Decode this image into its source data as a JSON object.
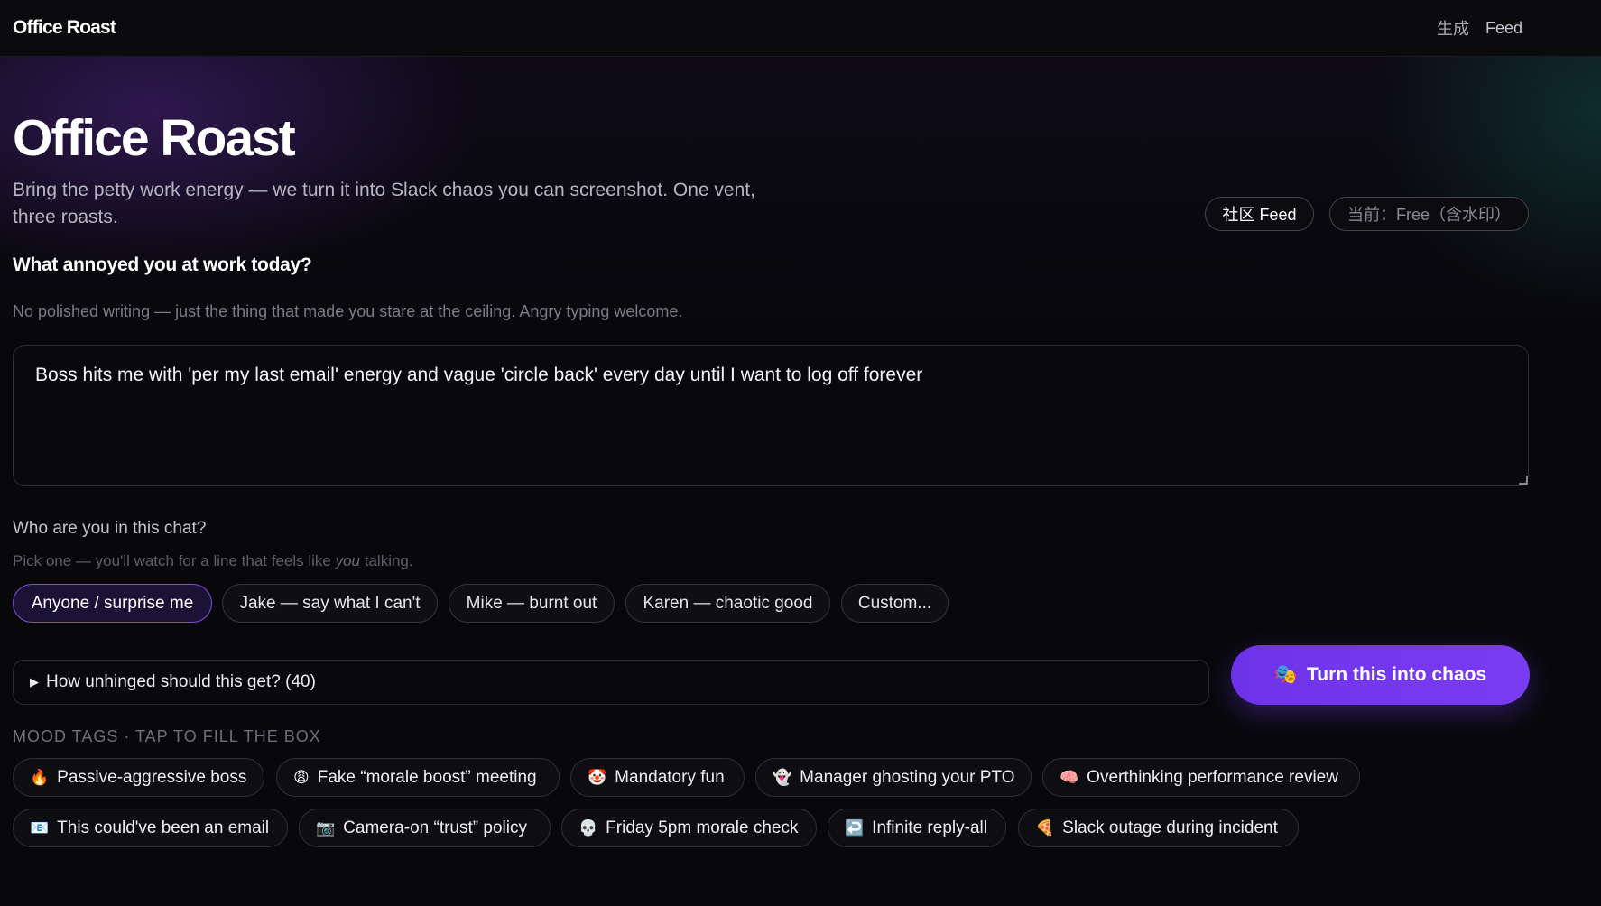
{
  "nav": {
    "brand": "Office Roast",
    "links": [
      "生成",
      "Feed"
    ]
  },
  "hero": {
    "title": "Office Roast",
    "subtitle": "Bring the petty work energy — we turn it into Slack chaos you can screenshot. One vent, three roasts.",
    "community_button": "社区 Feed",
    "plan_badge": "当前：Free（含水印）"
  },
  "vent": {
    "question": "What annoyed you at work today?",
    "hint": "No polished writing — just the thing that made you stare at the ceiling. Angry typing welcome.",
    "value": "Boss hits me with 'per my last email' energy and vague 'circle back' every day until I want to log off forever"
  },
  "persona": {
    "label": "Who are you in this chat?",
    "hint_before": "Pick one — you'll watch for a line that feels like ",
    "hint_em": "you",
    "hint_after": " talking.",
    "options": [
      "Anyone / surprise me",
      "Jake — say what I can't",
      "Mike — burnt out",
      "Karen — chaotic good",
      "Custom..."
    ],
    "selected": "Anyone / surprise me"
  },
  "unhinged": {
    "label": "How unhinged should this get? (40)",
    "value": 40
  },
  "cta": {
    "icon": "🎭",
    "label": "Turn this into chaos"
  },
  "mood": {
    "title": "MOOD TAGS · TAP TO FILL THE BOX",
    "tags": [
      {
        "emoji": "🔥",
        "icon": "fire-icon",
        "label": "Passive-aggressive boss"
      },
      {
        "emoji": "😩",
        "icon": "weary-face-icon",
        "label": "Fake “morale boost” meeting"
      },
      {
        "emoji": "🤡",
        "icon": "clown-face-icon",
        "label": "Mandatory fun"
      },
      {
        "emoji": "👻",
        "icon": "ghost-icon",
        "label": "Manager ghosting your PTO"
      },
      {
        "emoji": "🧠",
        "icon": "brain-icon",
        "label": "Overthinking performance review"
      },
      {
        "emoji": "📧",
        "icon": "email-icon",
        "label": "This could've been an email"
      },
      {
        "emoji": "📷",
        "icon": "camera-icon",
        "label": "Camera-on “trust” policy"
      },
      {
        "emoji": "💀",
        "icon": "skull-icon",
        "label": "Friday 5pm morale check"
      },
      {
        "emoji": "↩️",
        "icon": "reply-arrow-icon",
        "label": "Infinite reply-all"
      },
      {
        "emoji": "🍕",
        "icon": "pizza-icon",
        "label": "Slack outage during incident"
      }
    ]
  },
  "colors": {
    "accent": "#7a3cf0",
    "background": "#08080b",
    "active_chip_bg": "#1c1236"
  }
}
